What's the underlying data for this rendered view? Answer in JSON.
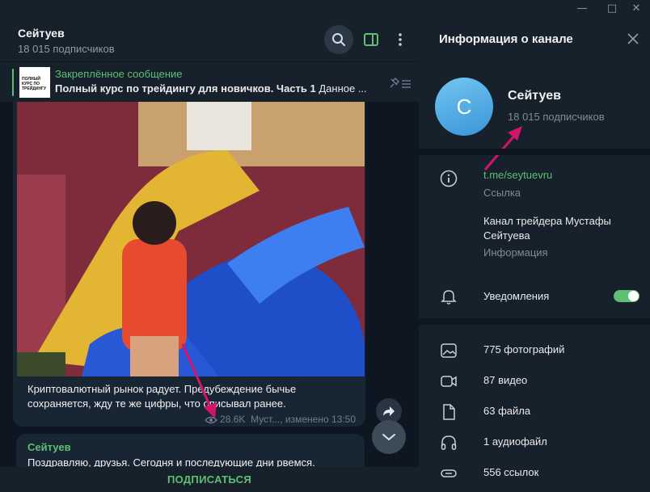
{
  "window": {
    "minimize_glyph": "—",
    "maximize_glyph": "□",
    "close_glyph": "✕"
  },
  "chat": {
    "title": "Сейтуев",
    "subtitle": "18 015 подписчиков",
    "icons": [
      "search-icon",
      "sidebar-toggle-icon",
      "more-vertical-icon"
    ]
  },
  "pinned": {
    "label": "Закреплённое сообщение",
    "title": "Полный курс по трейдингу для новичков. Часть 1",
    "preview": "Данное ...",
    "thumb_text": "ПОЛНЫЙ КУРС ПО ТРЕЙДИНГУ"
  },
  "message1": {
    "text": "Криптовалютный рынок радует. Предубеждение бычье сохраняется, жду те же цифры, что описывал ранее.",
    "views": "28.6K",
    "author": "Муст...",
    "edited": "изменено 13:50"
  },
  "message2": {
    "author": "Сейтуев",
    "text": "Поздравляю, друзья. Сегодня и последующие дни рвемся."
  },
  "subscribe": {
    "label": "ПОДПИСАТЬСЯ"
  },
  "info": {
    "header": "Информация о канале",
    "avatar_letter": "С",
    "name": "Сейтуев",
    "subscribers": "18 015 подписчиков",
    "link": "t.me/seytuevru",
    "link_label": "Ссылка",
    "description": "Канал трейдера Мустафы Сейтуева",
    "description_label": "Информация",
    "notifications_label": "Уведомления",
    "notifications_on": true,
    "media": [
      {
        "icon": "photo-icon",
        "label": "775 фотографий"
      },
      {
        "icon": "video-icon",
        "label": "87 видео"
      },
      {
        "icon": "file-icon",
        "label": "63 файла"
      },
      {
        "icon": "headphones-icon",
        "label": "1 аудиофайл"
      },
      {
        "icon": "link-icon",
        "label": "556 ссылок"
      }
    ]
  },
  "colors": {
    "accent": "#5fbf74",
    "arrow": "#d0156a",
    "chat_bg": "#0e1621",
    "panel_bg": "#17212b",
    "bubble_bg": "#182533"
  }
}
